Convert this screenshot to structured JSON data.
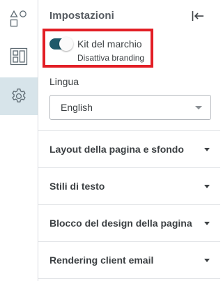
{
  "rail": {
    "items": [
      {
        "icon": "shapes-icon",
        "active": false
      },
      {
        "icon": "layout-icon",
        "active": false
      },
      {
        "icon": "gear-icon",
        "active": true
      }
    ]
  },
  "panel": {
    "title": "Impostazioni",
    "collapse_icon": "collapse-left-icon",
    "brand_kit": {
      "label": "Kit del marchio",
      "sublabel": "Disattiva branding",
      "toggle_on": true
    },
    "language": {
      "label": "Lingua",
      "value": "English"
    },
    "sections": [
      {
        "label": "Layout della pagina e sfondo"
      },
      {
        "label": "Stili di testo"
      },
      {
        "label": "Blocco del design della pagina"
      },
      {
        "label": "Rendering client email"
      }
    ]
  },
  "colors": {
    "toggle_track": "#205a6a",
    "highlight_border": "#e21e25",
    "active_rail_bg": "#d7e4ea"
  }
}
